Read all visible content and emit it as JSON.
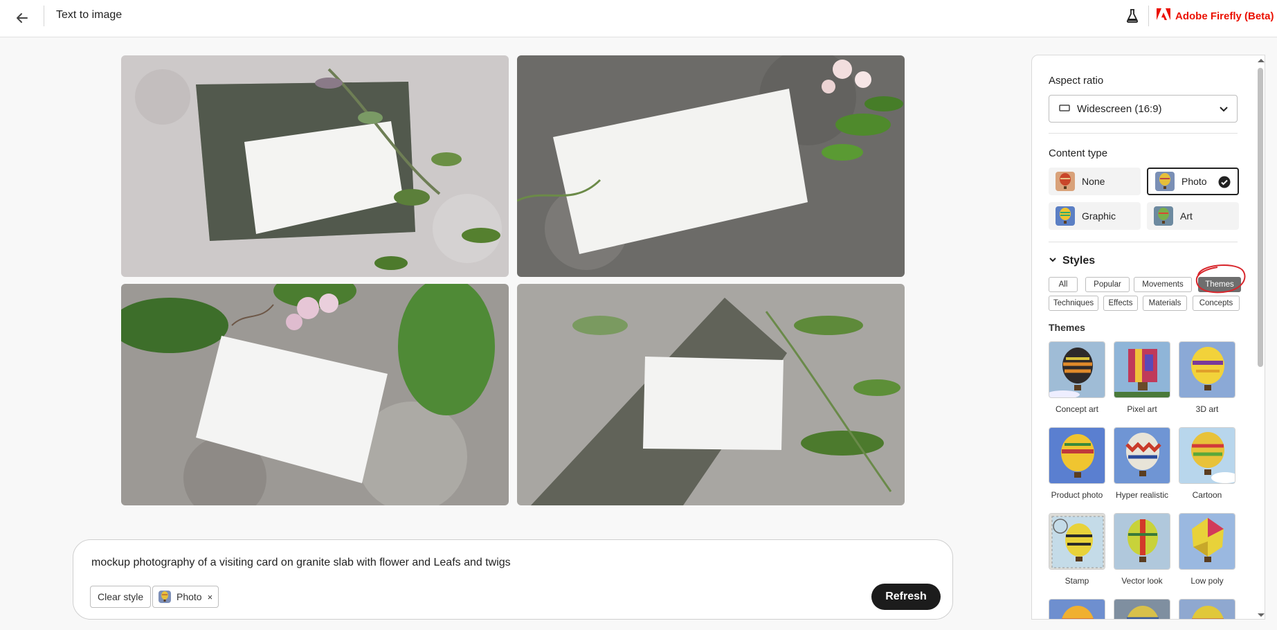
{
  "header": {
    "title": "Text to image",
    "brand": "Adobe Firefly (Beta)",
    "brand_color": "#eb1000",
    "icons": [
      "back-arrow-icon",
      "lab-flask-icon",
      "adobe-logo-icon"
    ]
  },
  "images": [
    {
      "name": "generated-image-1"
    },
    {
      "name": "generated-image-2"
    },
    {
      "name": "generated-image-3"
    },
    {
      "name": "generated-image-4"
    }
  ],
  "prompt": {
    "text": "mockup photography of a visiting card on granite slab with flower and Leafs and twigs",
    "clear_style_label": "Clear style",
    "chip_label": "Photo",
    "chip_remove": "×",
    "refresh_label": "Refresh"
  },
  "panel": {
    "aspect_ratio": {
      "label": "Aspect ratio",
      "value": "Widescreen (16:9)"
    },
    "content_type": {
      "label": "Content type",
      "options": [
        {
          "label": "None",
          "selected": false
        },
        {
          "label": "Photo",
          "selected": true
        },
        {
          "label": "Graphic",
          "selected": false
        },
        {
          "label": "Art",
          "selected": false
        }
      ]
    },
    "styles": {
      "label": "Styles",
      "tabs": [
        {
          "label": "All"
        },
        {
          "label": "Popular"
        },
        {
          "label": "Movements"
        },
        {
          "label": "Themes",
          "active": true
        },
        {
          "label": "Techniques"
        },
        {
          "label": "Effects"
        },
        {
          "label": "Materials"
        },
        {
          "label": "Concepts"
        }
      ],
      "section_label": "Themes",
      "themes": [
        {
          "label": "Concept art"
        },
        {
          "label": "Pixel art"
        },
        {
          "label": "3D art"
        },
        {
          "label": "Product photo"
        },
        {
          "label": "Hyper realistic"
        },
        {
          "label": "Cartoon"
        },
        {
          "label": "Stamp"
        },
        {
          "label": "Vector look"
        },
        {
          "label": "Low poly"
        }
      ]
    }
  }
}
